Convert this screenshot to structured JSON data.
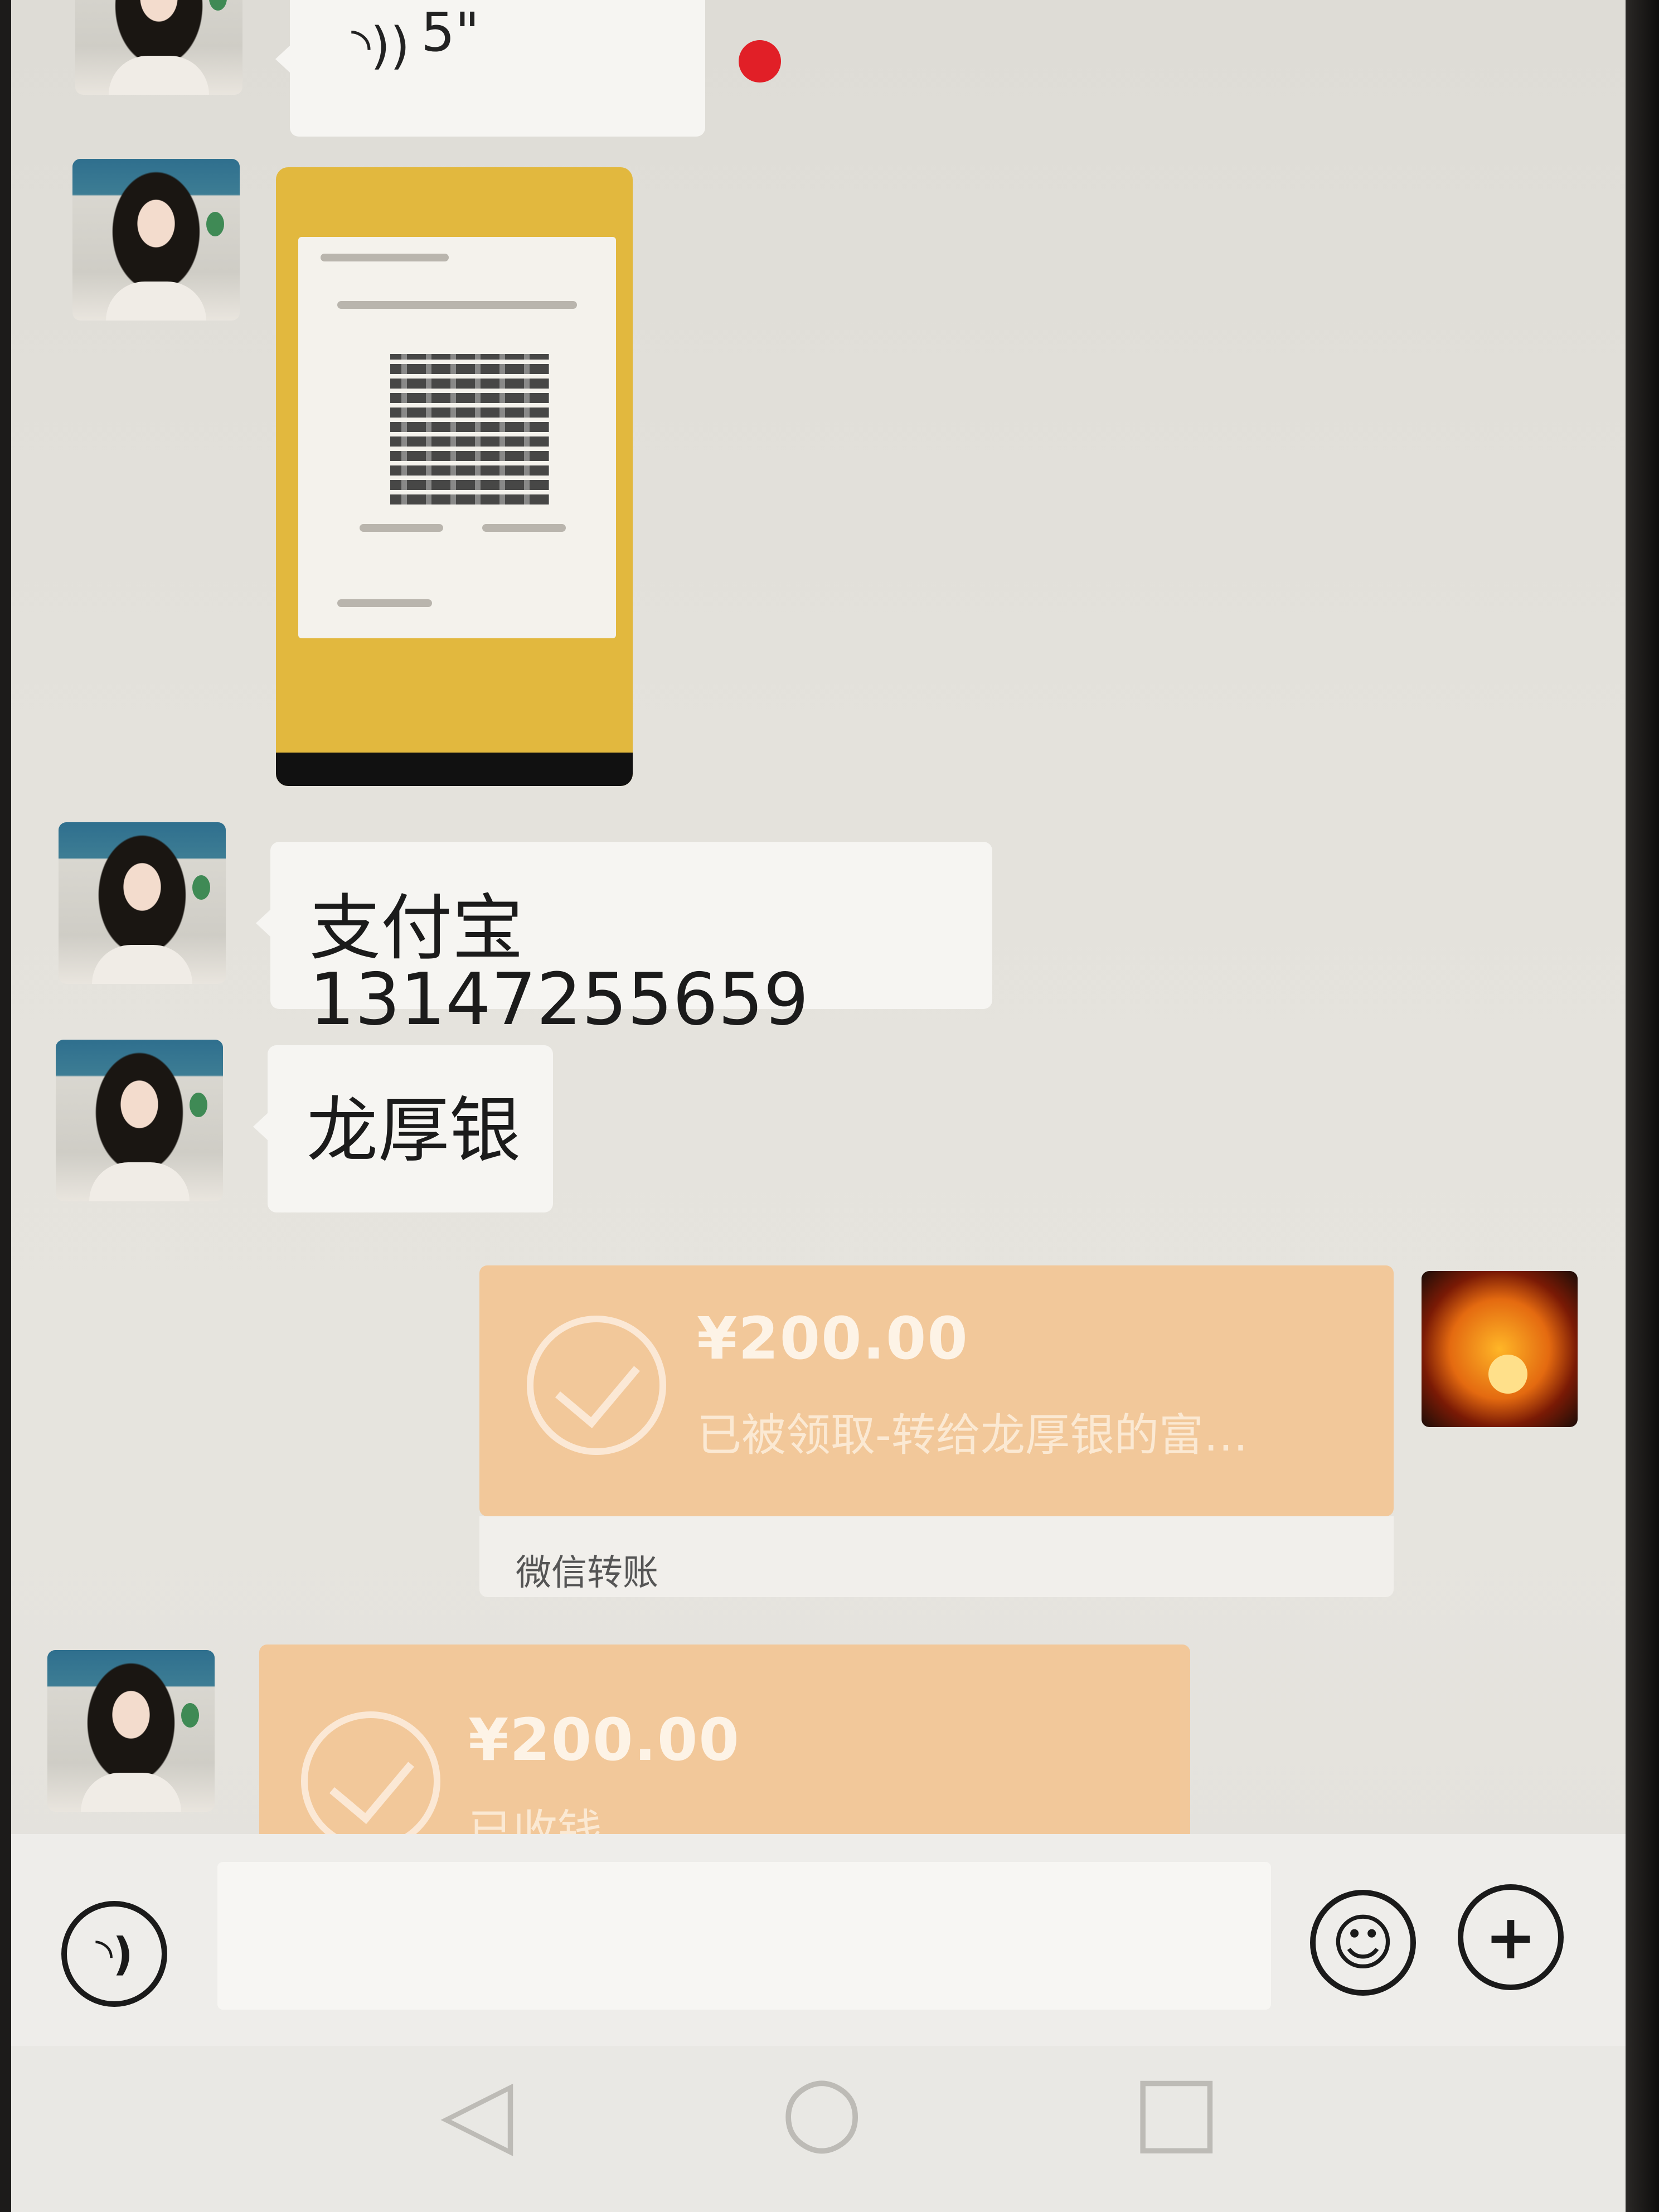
{
  "chat": {
    "voice_message": {
      "duration": "5\"",
      "icon": "voice-wave-icon",
      "unread_color": "#e11f27"
    },
    "alipay_message": "支付宝 13147255659",
    "name_message": "龙厚银",
    "sent_transfer": {
      "amount": "¥200.00",
      "status": "已被领取-转给龙厚银的富…",
      "footer": "微信转账"
    },
    "received_transfer": {
      "amount": "¥200.00",
      "status": "已收钱"
    }
  },
  "input_bar": {
    "voice_button_icon": "voice-input-icon",
    "emoji_button_icon": "emoji-icon",
    "more_button_icon": "plus-circle-icon"
  },
  "nav": {
    "back_icon": "back-triangle-icon",
    "home_icon": "home-circle-icon",
    "recent_icon": "recent-square-icon"
  },
  "colors": {
    "transfer_bg": "#f2c89a",
    "qr_card_bg": "#e2b83e",
    "bubble_bg": "#f6f5f2"
  }
}
